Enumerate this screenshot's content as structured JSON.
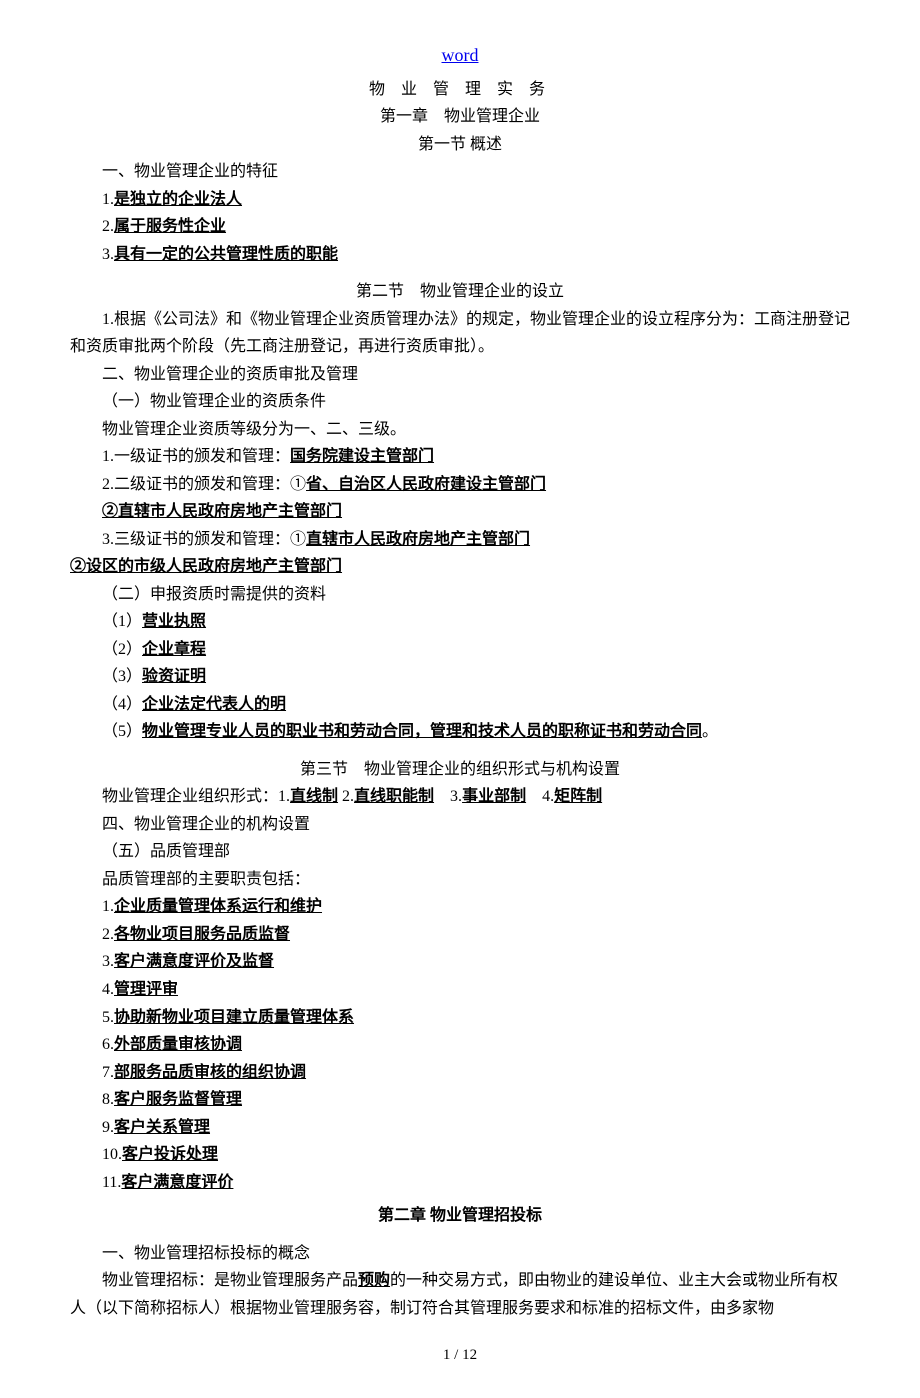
{
  "header": {
    "link": "word"
  },
  "titles": {
    "main_spaced": "物 业 管 理 实 务",
    "chapter1": "第一章　物业管理企业",
    "section1": "第一节 概述",
    "section2": "第二节　物业管理企业的设立",
    "section3": "第三节　物业管理企业的组织形式与机构设置",
    "chapter2": "第二章 物业管理招投标"
  },
  "s1": {
    "h1": "一、物业管理企业的特征",
    "l1p": "1.",
    "l1u": "是独立的企业法人",
    "l2p": "2.",
    "l2u": "属于服务性企业",
    "l3p": "3.",
    "l3u": "具有一定的公共管理性质的职能"
  },
  "s2": {
    "p1": "1.根据《公司法》和《物业管理企业资质管理办法》的规定，物业管理企业的设立程序分为：工商注册登记和资质审批两个阶段（先工商注册登记，再进行资质审批）。",
    "h2": "二、物业管理企业的资质审批及管理",
    "h2a": "（一）物业管理企业的资质条件",
    "p2": "物业管理企业资质等级分为一、二、三级。",
    "l1a": "1.一级证书的颁发和管理：",
    "l1u": "国务院建设主管部门",
    "l2a": "2.二级证书的颁发和管理：①",
    "l2u": "省、自治区人民政府建设主管部门",
    "l3p": "②",
    "l3u": "直辖市人民政府房地产主管部门",
    "l4a": "3.三级证书的颁发和管理：①",
    "l4u": "直辖市人民政府房地产主管部门",
    "l5p": "②",
    "l5u": "设区的市级人民政府房地产主管部门",
    "h2b": "（二）申报资质时需提供的资料",
    "d1p": "（1）",
    "d1u": "营业执照",
    "d2p": "（2）",
    "d2u": "企业章程",
    "d3p": "（3）",
    "d3u": "验资证明",
    "d4p": "（4）",
    "d4u": "企业法定代表人的明",
    "d5p": "（5）",
    "d5u": "物业管理专业人员的职业书和劳动合同，管理和技术人员的职称证书和劳动合同",
    "d5e": "。"
  },
  "s3": {
    "pfa": "物业管理企业组织形式：1.",
    "pf1": "直线制",
    "pfb": " 2.",
    "pf2": "直线职能制",
    "pfc": "　3.",
    "pf3": "事业部制",
    "pfd": "　4.",
    "pf4": "矩阵制",
    "h4": "四、物业管理企业的机构设置",
    "h5": "（五）品质管理部",
    "p5": "品质管理部的主要职责包括：",
    "q1p": "1.",
    "q1u": "企业质量管理体系运行和维护",
    "q2p": "2.",
    "q2u": "各物业项目服务品质监督",
    "q3p": "3.",
    "q3u": "客户满意度评价及监督",
    "q4p": "4.",
    "q4u": "管理评审",
    "q5p": "5.",
    "q5u": "协助新物业项目建立质量管理体系",
    "q6p": "6.",
    "q6u": "外部质量审核协调",
    "q7p": "7.",
    "q7u": "部服务品质审核的组织协调",
    "q8p": "8.",
    "q8u": "客户服务监督管理",
    "q9p": "9.",
    "q9u": "客户关系管理",
    "q10p": "10.",
    "q10u": "客户投诉处理",
    "q11p": "11.",
    "q11u": "客户满意度评价"
  },
  "c2": {
    "h1": "一、物业管理招标投标的概念",
    "p1a": "物业管理招标：是物业管理服务产品",
    "p1u": "预购",
    "p1b": "的一种交易方式，即由物业的建设单位、业主大会或物业所有权人（以下简称招标人）根据物业管理服务容，制订符合其管理服务要求和标准的招标文件，由多家物"
  },
  "footer": {
    "page": "1 / 12"
  }
}
